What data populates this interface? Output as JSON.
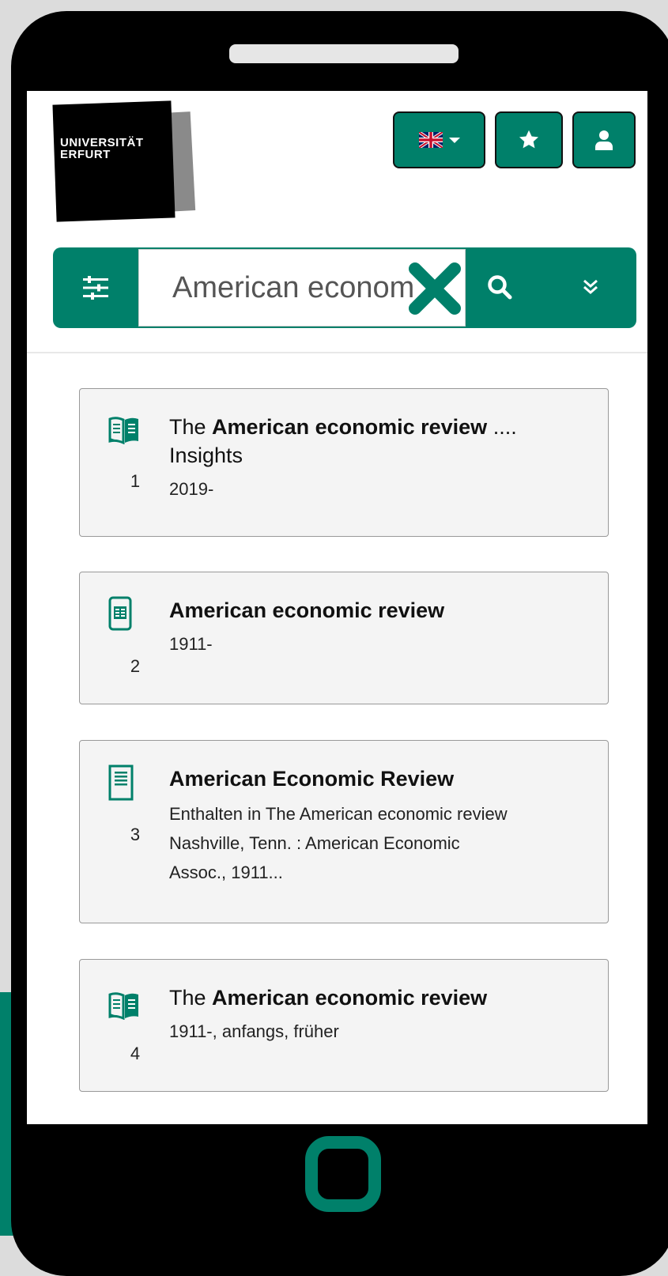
{
  "logo": {
    "line1": "UNIVERSITÄT",
    "line2": "ERFURT"
  },
  "toolbar": {
    "language_icon": "uk-flag-icon",
    "favorites_icon": "star-icon",
    "account_icon": "user-icon"
  },
  "search": {
    "value": "American econom",
    "filter_icon": "sliders-icon",
    "clear_icon": "close-icon",
    "search_icon": "search-icon",
    "expand_icon": "double-chevron-down-icon"
  },
  "results": [
    {
      "number": "1",
      "icon": "ebook-icon",
      "title_prefix": "The ",
      "title_bold": "American economic review",
      "title_suffix": " .... Insights",
      "meta": [
        "2019-"
      ]
    },
    {
      "number": "2",
      "icon": "mobile-ejournal-icon",
      "title_prefix": "",
      "title_bold": "American economic review",
      "title_suffix": "",
      "meta": [
        "1911-"
      ]
    },
    {
      "number": "3",
      "icon": "article-icon",
      "title_prefix": "",
      "title_bold": "American Economic Review",
      "title_suffix": "",
      "meta": [
        "Enthalten in The American economic review",
        "Nashville, Tenn. : American Economic",
        "Assoc., 1911..."
      ]
    },
    {
      "number": "4",
      "icon": "ebook-icon",
      "title_prefix": "The ",
      "title_bold": "American economic review",
      "title_suffix": "",
      "meta": [
        "1911-, anfangs, früher"
      ]
    }
  ],
  "colors": {
    "accent": "#00806a",
    "card_bg": "#f4f4f4"
  }
}
